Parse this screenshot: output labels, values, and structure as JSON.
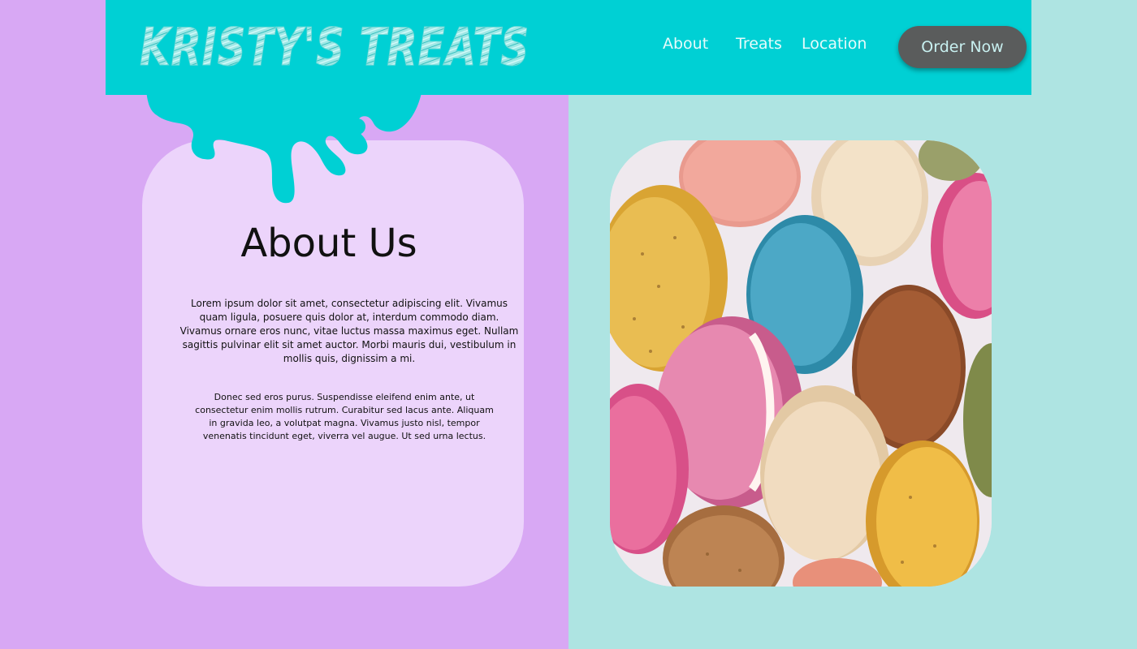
{
  "header": {
    "logo_text": "KRISTY'S TREATS",
    "nav": [
      {
        "label": "About"
      },
      {
        "label": "Treats"
      },
      {
        "label": "Location"
      }
    ],
    "order_button": "Order Now"
  },
  "about": {
    "title": "About Us",
    "paragraph1": "Lorem ipsum dolor sit amet, consectetur adipiscing elit. Vivamus quam ligula, posuere quis dolor at, interdum commodo diam. Vivamus ornare eros nunc, vitae luctus massa maximus eget. Nullam sagittis pulvinar elit sit amet auctor. Morbi mauris dui, vestibulum in mollis quis, dignissim a mi.",
    "paragraph2": "Donec sed eros purus. Suspendisse eleifend enim ante, ut consectetur enim mollis rutrum. Curabitur sed lacus ante. Aliquam in gravida leo, a volutpat magna. Vivamus justo nisl, tempor venenatis tincidunt eget, viverra vel augue. Ut sed urna lectus."
  },
  "colors": {
    "header_bg": "#00d0d4",
    "left_bg": "#d8a8f4",
    "right_bg": "#aee4e2",
    "card_bg": "#ecd4fb",
    "button_bg": "#5a5c5c"
  },
  "image": {
    "subject": "macarons-photo"
  }
}
